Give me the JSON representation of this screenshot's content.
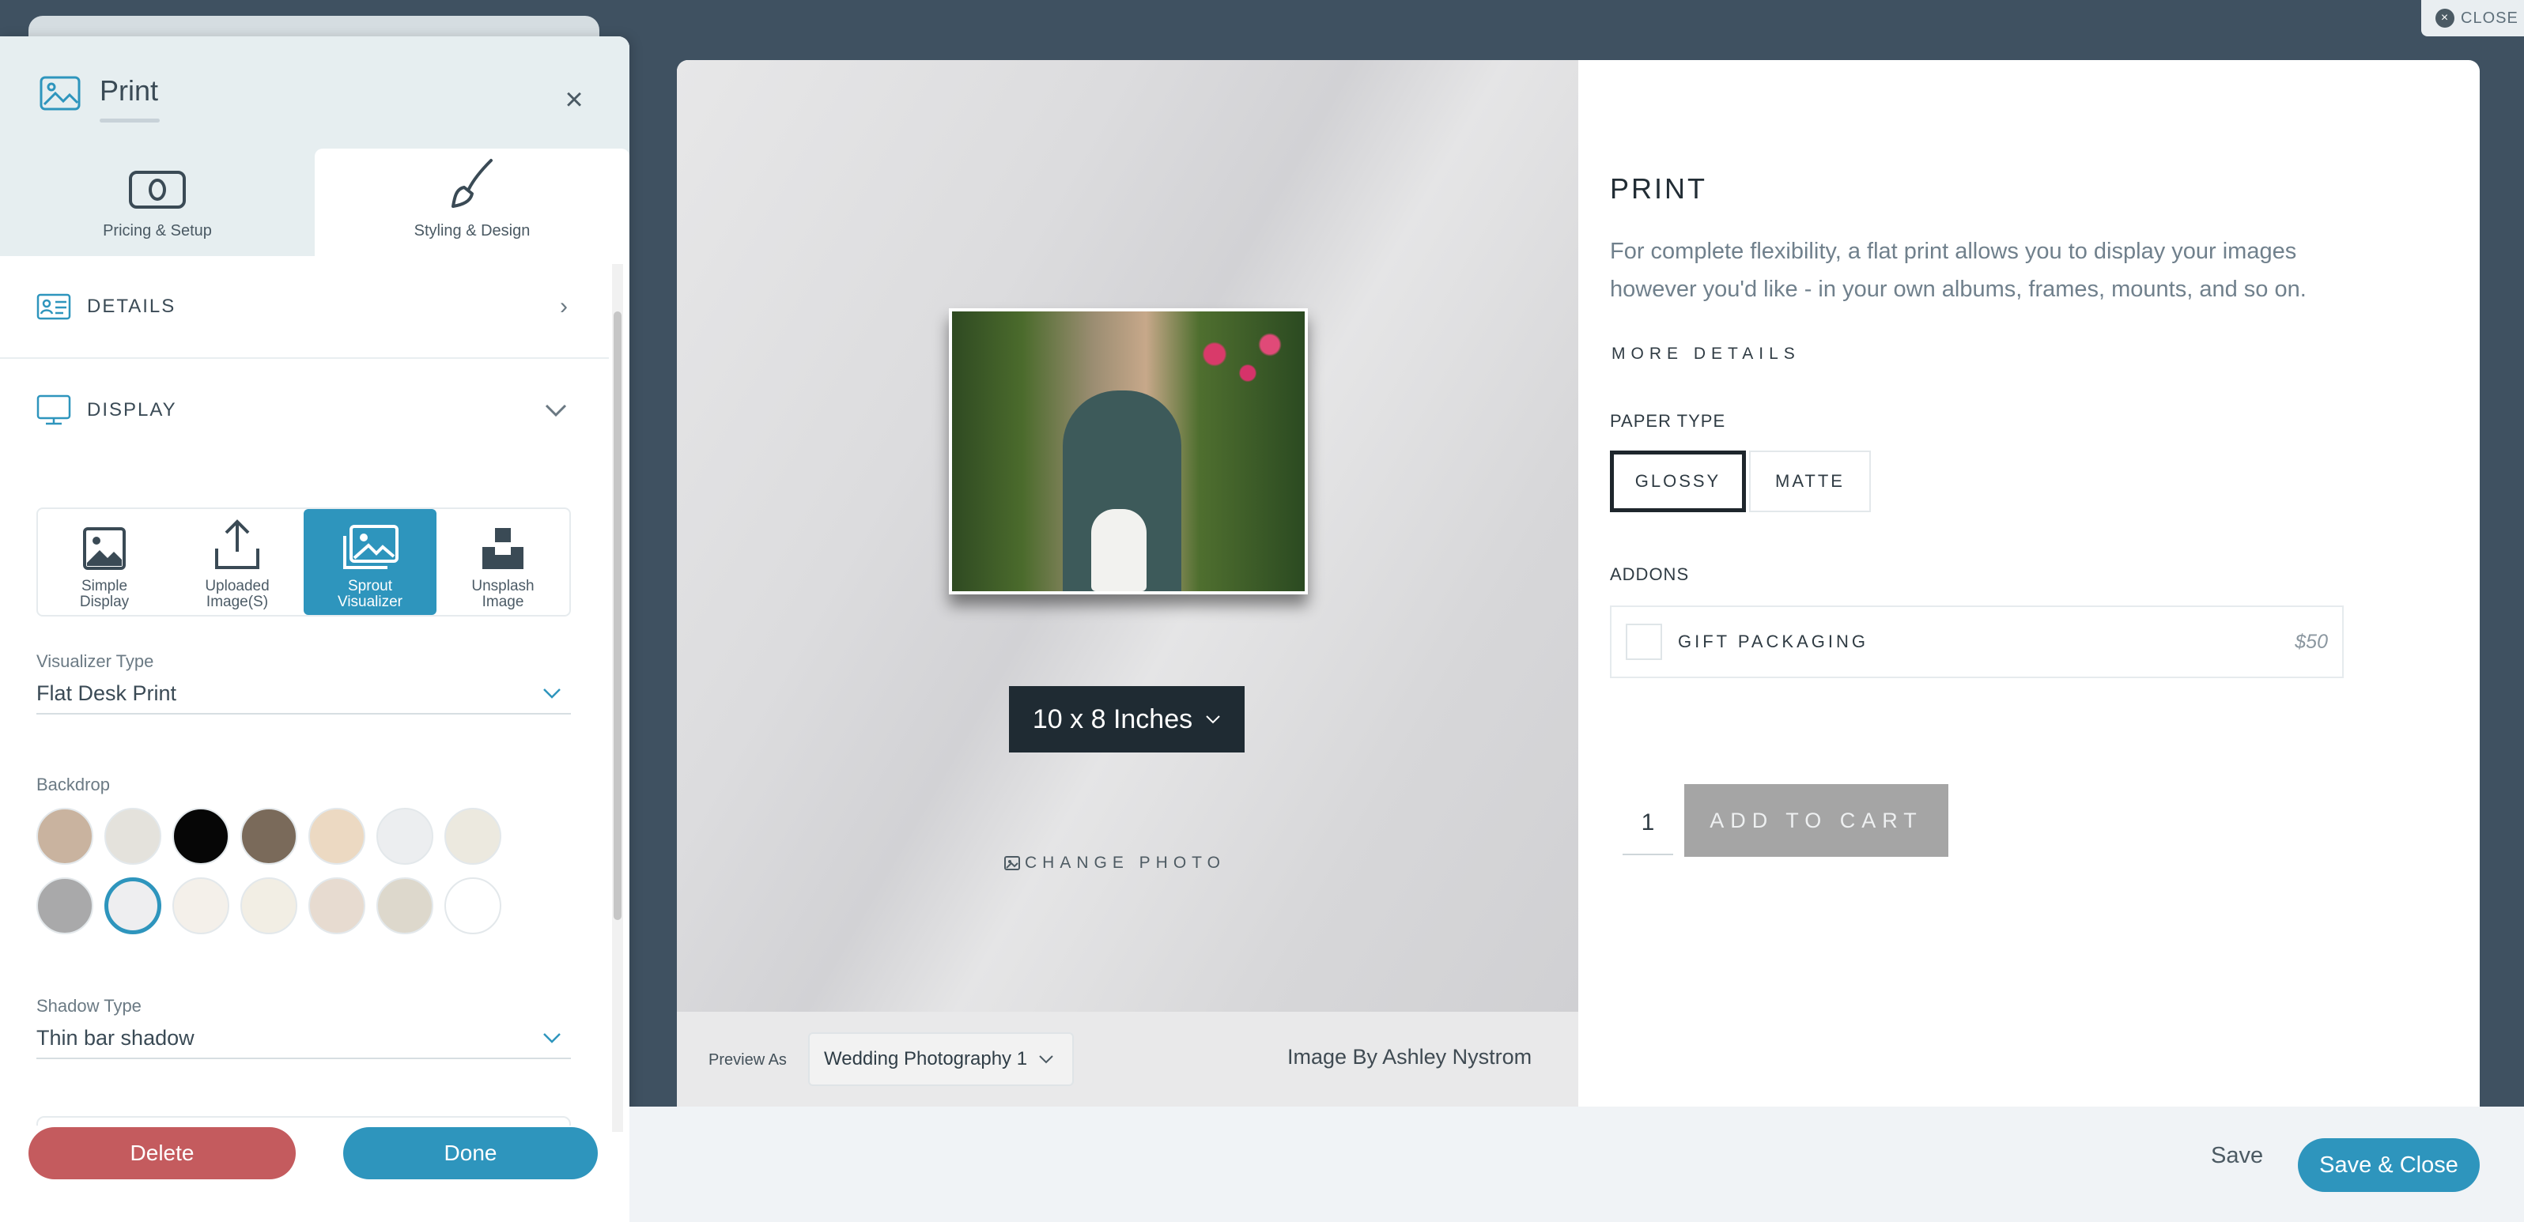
{
  "top": {
    "close_label": "CLOSE"
  },
  "panel": {
    "title": "Print",
    "tabs": [
      {
        "label": "Pricing & Setup",
        "icon": "money-icon"
      },
      {
        "label": "Styling & Design",
        "icon": "paintbrush-icon"
      }
    ],
    "sections": [
      {
        "label": "DETAILS",
        "icon": "id-card-icon"
      },
      {
        "label": "DISPLAY",
        "icon": "monitor-icon"
      }
    ],
    "display_options": [
      {
        "label_1": "Simple",
        "label_2": "Display"
      },
      {
        "label_1": "Uploaded",
        "label_2": "Image(S)"
      },
      {
        "label_1": "Sprout",
        "label_2": "Visualizer"
      },
      {
        "label_1": "Unsplash",
        "label_2": "Image"
      }
    ],
    "visualizer_type_label": "Visualizer Type",
    "visualizer_type_value": "Flat Desk Print",
    "backdrop_label": "Backdrop",
    "backdrops": [
      "#c9b39f",
      "#e4e2dc",
      "#060606",
      "#7a6a5a",
      "#ecd9c2",
      "#eceef0",
      "#ece9df",
      "#a9a9aa",
      "#eeeef0",
      "#f4f0ea",
      "#f2eee4",
      "#e7dbd0",
      "#ddd8cc",
      "#ffffff"
    ],
    "shadow_type_label": "Shadow Type",
    "shadow_type_value": "Thin bar shadow",
    "delete_label": "Delete",
    "done_label": "Done"
  },
  "preview": {
    "size_label": "10 x 8 Inches",
    "change_photo_label": "CHANGE PHOTO",
    "preview_as_label": "Preview As",
    "preview_as_value": "Wedding Photography 1",
    "credit": "Image By Ashley Nystrom"
  },
  "product": {
    "title": "PRINT",
    "description": "For complete flexibility, a flat print allows you to display your images however you'd like - in your own albums, frames, mounts, and so on.",
    "more_details": "MORE DETAILS",
    "paper_type_label": "PAPER TYPE",
    "paper_types": [
      "GLOSSY",
      "MATTE"
    ],
    "addons_label": "ADDONS",
    "addon_name": "GIFT PACKAGING",
    "addon_price": "$50",
    "quantity": "1",
    "add_to_cart": "ADD TO CART"
  },
  "footer": {
    "save_label": "Save",
    "save_close_label": "Save & Close"
  },
  "colors": {
    "accent": "#2e95bd",
    "danger": "#c45b5e",
    "dark": "#1f2b33"
  }
}
